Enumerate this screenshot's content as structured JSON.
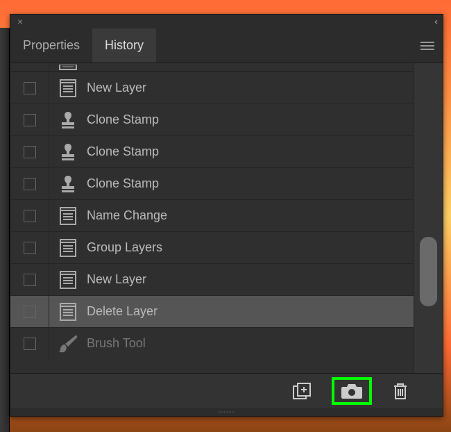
{
  "titlebar": {
    "close_glyph": "×",
    "collapse_glyph": "‹‹"
  },
  "tabs": {
    "properties": "Properties",
    "history": "History"
  },
  "history": {
    "items": [
      {
        "icon": "layer",
        "label": "New Layer",
        "state": "normal"
      },
      {
        "icon": "stamp",
        "label": "Clone Stamp",
        "state": "normal"
      },
      {
        "icon": "stamp",
        "label": "Clone Stamp",
        "state": "normal"
      },
      {
        "icon": "stamp",
        "label": "Clone Stamp",
        "state": "normal"
      },
      {
        "icon": "layer",
        "label": "Name Change",
        "state": "normal"
      },
      {
        "icon": "layer",
        "label": "Group Layers",
        "state": "normal"
      },
      {
        "icon": "layer",
        "label": "New Layer",
        "state": "normal"
      },
      {
        "icon": "layer",
        "label": "Delete Layer",
        "state": "active"
      },
      {
        "icon": "brush",
        "label": "Brush Tool",
        "state": "future"
      }
    ]
  },
  "grip": "▫▫▫▫▫▫"
}
